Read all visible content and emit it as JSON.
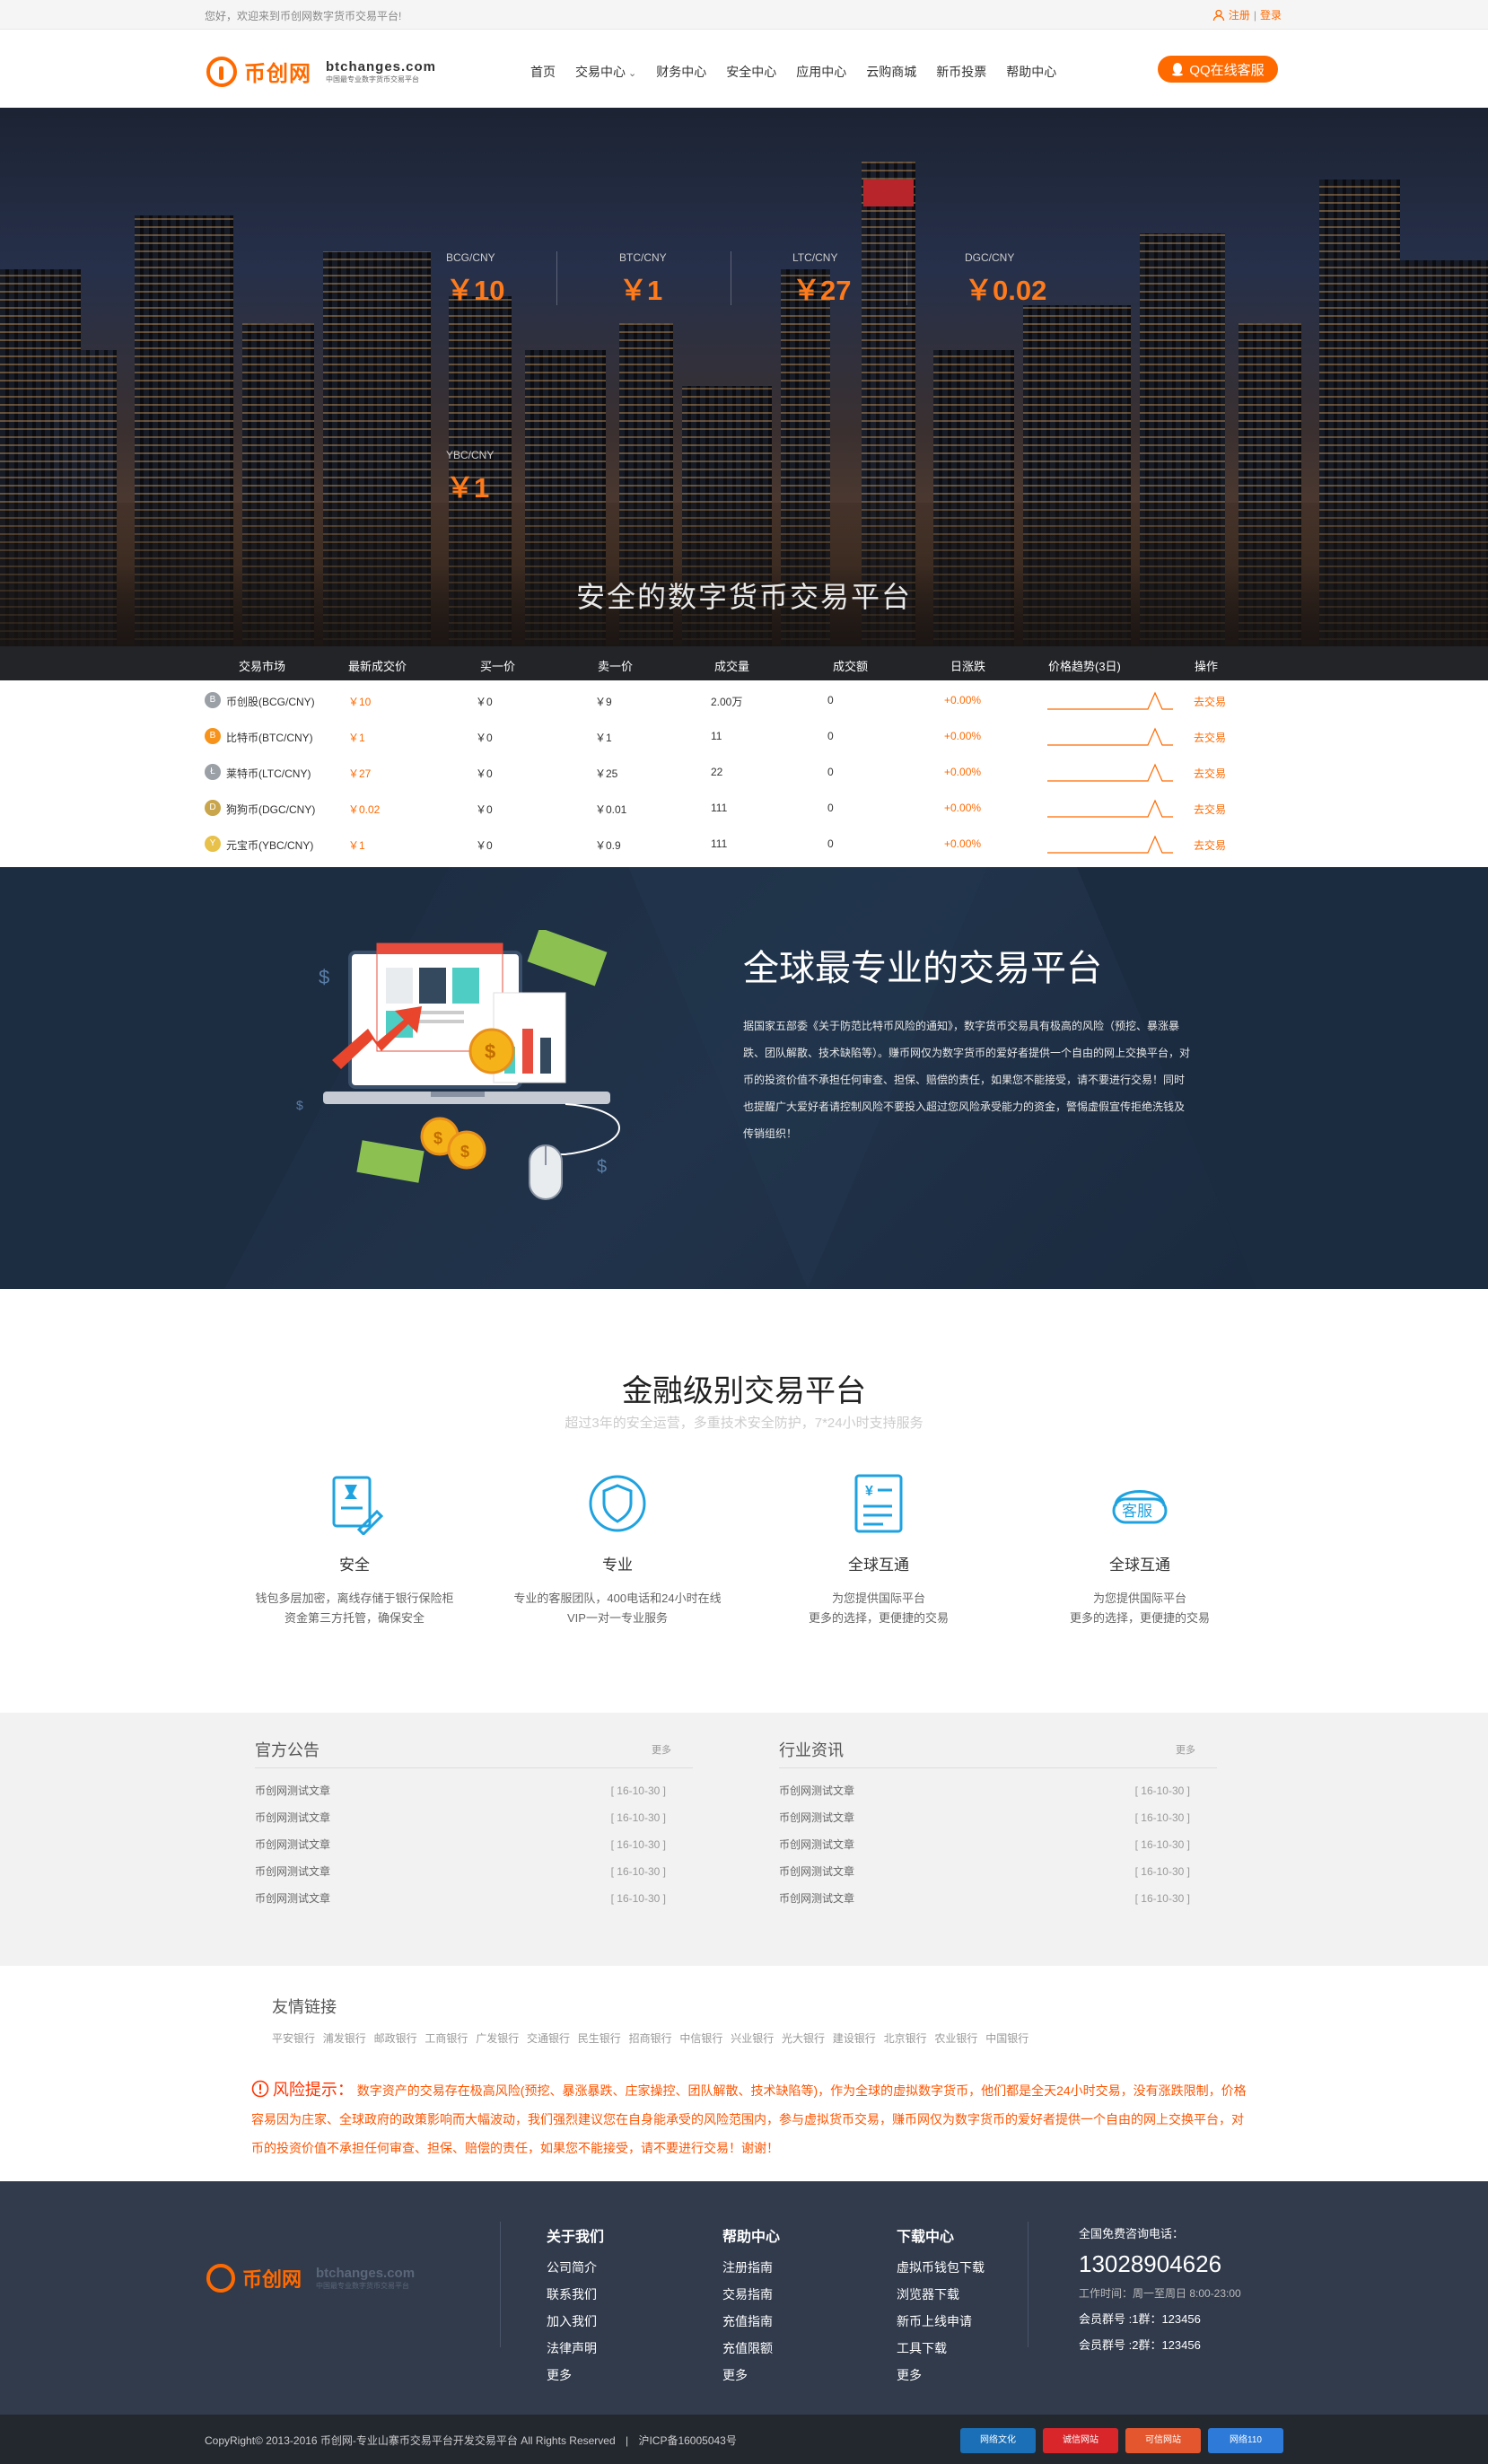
{
  "topbar": {
    "welcome": "您好，欢迎来到币创网数字货币交易平台!",
    "register": "注册",
    "sep": "|",
    "login": "登录"
  },
  "logo": {
    "brand": "币创网",
    "domain": "btchanges.com",
    "tagline": "中国最专业数字货币交易平台"
  },
  "nav": [
    "首页",
    "交易中心",
    "财务中心",
    "安全中心",
    "应用中心",
    "云购商城",
    "新币投票",
    "帮助中心"
  ],
  "qq": {
    "label": "QQ在线客服"
  },
  "tickers": [
    {
      "pair": "BCG/CNY",
      "price": "￥10"
    },
    {
      "pair": "BTC/CNY",
      "price": "￥1"
    },
    {
      "pair": "LTC/CNY",
      "price": "￥27"
    },
    {
      "pair": "DGC/CNY",
      "price": "￥0.02"
    },
    {
      "pair": "YBC/CNY",
      "price": "￥1"
    }
  ],
  "hero_title": "安全的数字货币交易平台",
  "market": {
    "headers": [
      "交易市场",
      "最新成交价",
      "买一价",
      "卖一价",
      "成交量",
      "成交额",
      "日涨跌",
      "价格趋势(3日)",
      "操作"
    ],
    "rows": [
      {
        "name": "币创股(BCG/CNY)",
        "last": "￥10",
        "buy": "￥0",
        "sell": "￥9",
        "vol": "2.00万",
        "amt": "0",
        "chg": "+0.00%",
        "action": "去交易",
        "color": "#9aa0a6",
        "glyph": "B"
      },
      {
        "name": "比特币(BTC/CNY)",
        "last": "￥1",
        "buy": "￥0",
        "sell": "￥1",
        "vol": "11",
        "amt": "0",
        "chg": "+0.00%",
        "action": "去交易",
        "color": "#f7931a",
        "glyph": "B"
      },
      {
        "name": "莱特币(LTC/CNY)",
        "last": "￥27",
        "buy": "￥0",
        "sell": "￥25",
        "vol": "22",
        "amt": "0",
        "chg": "+0.00%",
        "action": "去交易",
        "color": "#9aa0a6",
        "glyph": "Ł"
      },
      {
        "name": "狗狗币(DGC/CNY)",
        "last": "￥0.02",
        "buy": "￥0",
        "sell": "￥0.01",
        "vol": "111",
        "amt": "0",
        "chg": "+0.00%",
        "action": "去交易",
        "color": "#c9a54b",
        "glyph": "D"
      },
      {
        "name": "元宝币(YBC/CNY)",
        "last": "￥1",
        "buy": "￥0",
        "sell": "￥0.9",
        "vol": "111",
        "amt": "0",
        "chg": "+0.00%",
        "action": "去交易",
        "color": "#e8c14a",
        "glyph": "Y"
      }
    ]
  },
  "pro": {
    "title": "全球最专业的交易平台",
    "text": "据国家五部委《关于防范比特币风险的通知》，数字货币交易具有极高的风险（预挖、暴涨暴跌、团队解散、技术缺陷等）。赚币网仅为数字货币的爱好者提供一个自由的网上交换平台，对币的投资价值不承担任何审查、担保、赔偿的责任，如果您不能接受，请不要进行交易！同时也提醒广大爱好者请控制风险不要投入超过您风险承受能力的资金，警惕虚假宣传拒绝洗钱及传销组织！"
  },
  "finance": {
    "title": "金融级别交易平台",
    "subtitle": "超过3年的安全运营，多重技术安全防护，7*24小时支持服务",
    "features": [
      {
        "title": "安全",
        "desc1": "钱包多层加密，离线存储于银行保险柜",
        "desc2": "资金第三方托管，确保安全"
      },
      {
        "title": "专业",
        "desc1": "专业的客服团队，400电话和24小时在线",
        "desc2": "VIP一对一专业服务"
      },
      {
        "title": "全球互通",
        "desc1": "为您提供国际平台",
        "desc2": "更多的选择，更便捷的交易"
      },
      {
        "title": "全球互通",
        "desc1": "为您提供国际平台",
        "desc2": "更多的选择，更便捷的交易"
      }
    ],
    "kefu_icon_text": "客服"
  },
  "news": {
    "left": {
      "title": "官方公告",
      "more": "更多",
      "items": [
        {
          "t": "币创网测试文章",
          "d": "[ 16-10-30 ]"
        },
        {
          "t": "币创网测试文章",
          "d": "[ 16-10-30 ]"
        },
        {
          "t": "币创网测试文章",
          "d": "[ 16-10-30 ]"
        },
        {
          "t": "币创网测试文章",
          "d": "[ 16-10-30 ]"
        },
        {
          "t": "币创网测试文章",
          "d": "[ 16-10-30 ]"
        }
      ]
    },
    "right": {
      "title": "行业资讯",
      "more": "更多",
      "items": [
        {
          "t": "币创网测试文章",
          "d": "[ 16-10-30 ]"
        },
        {
          "t": "币创网测试文章",
          "d": "[ 16-10-30 ]"
        },
        {
          "t": "币创网测试文章",
          "d": "[ 16-10-30 ]"
        },
        {
          "t": "币创网测试文章",
          "d": "[ 16-10-30 ]"
        },
        {
          "t": "币创网测试文章",
          "d": "[ 16-10-30 ]"
        }
      ]
    }
  },
  "links": {
    "title": "友情链接",
    "banks": [
      "平安银行",
      "浦发银行",
      "邮政银行",
      "工商银行",
      "广发银行",
      "交通银行",
      "民生银行",
      "招商银行",
      "中信银行",
      "兴业银行",
      "光大银行",
      "建设银行",
      "北京银行",
      "农业银行",
      "中国银行"
    ]
  },
  "risk": {
    "label": "风险提示：",
    "text": "数字资产的交易存在极高风险(预挖、暴涨暴跌、庄家操控、团队解散、技术缺陷等)，作为全球的虚拟数字货币，他们都是全天24小时交易，没有涨跌限制，价格容易因为庄家、全球政府的政策影响而大幅波动，我们强烈建议您在自身能承受的风险范围内，参与虚拟货币交易，赚币网仅为数字货币的爱好者提供一个自由的网上交换平台，对币的投资价值不承担任何审查、担保、赔偿的责任，如果您不能接受，请不要进行交易！谢谢！"
  },
  "footer": {
    "cols": [
      {
        "title": "关于我们",
        "items": [
          "公司简介",
          "联系我们",
          "加入我们",
          "法律声明",
          "更多"
        ]
      },
      {
        "title": "帮助中心",
        "items": [
          "注册指南",
          "交易指南",
          "充值指南",
          "充值限额",
          "更多"
        ]
      },
      {
        "title": "下载中心",
        "items": [
          "虚拟币钱包下载",
          "浏览器下载",
          "新币上线申请",
          "工具下载",
          "更多"
        ]
      }
    ],
    "hotline_label": "全国免费咨询电话：",
    "phone": "13028904626",
    "hours": "工作时间：周一至周日 8:00-23:00",
    "group1": "会员群号 :1群：123456",
    "group2": "会员群号 :2群：123456"
  },
  "copyright": {
    "text": "CopyRight© 2013-2016 币创网-专业山寨币交易平台开发交易平台 All Rights Reserved",
    "sep": "|",
    "icp": "沪ICP备16005043号",
    "badges": [
      {
        "label": "网络文化",
        "color": "#1a6fb7"
      },
      {
        "label": "诚信网站",
        "color": "#d9262b"
      },
      {
        "label": "可信网站",
        "color": "#e4572e"
      },
      {
        "label": "网络110",
        "color": "#2d7ad8"
      }
    ]
  }
}
